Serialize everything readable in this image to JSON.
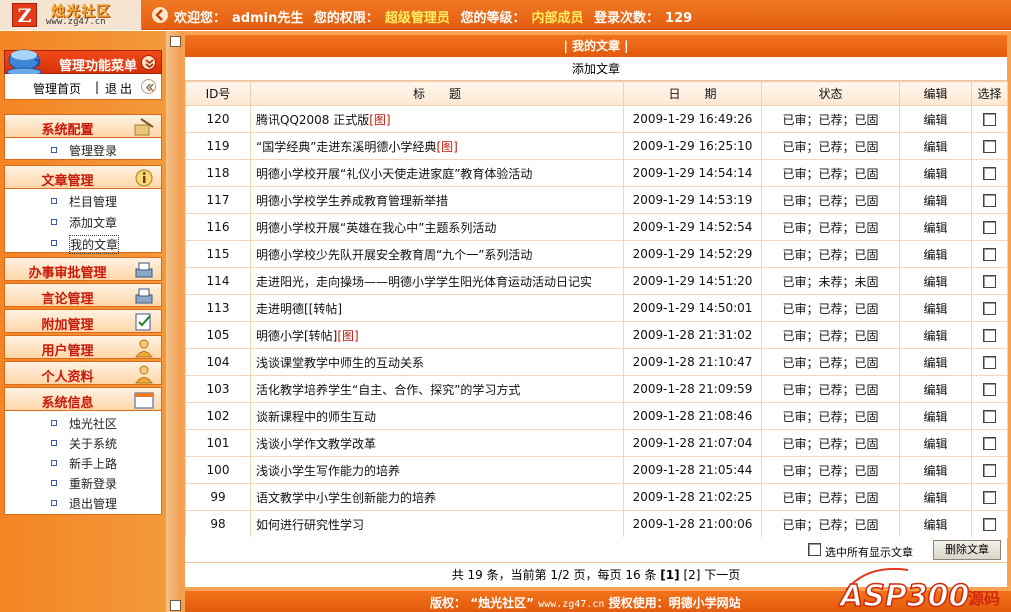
{
  "header": {
    "logo_letter": "Z",
    "logo_name": "烛光社区",
    "logo_url": "www.zg47.cn",
    "welcome_label": "欢迎您：",
    "username": "admin先生",
    "permission_label": "您的权限：",
    "permission": "超级管理员",
    "level_label": "您的等级：",
    "level": "内部成员",
    "login_count_label": "登录次数：",
    "login_count": "129"
  },
  "sidebar": {
    "manager_menu_title": "管理功能菜单",
    "home_link": "管理首页",
    "separator": "|",
    "exit_link": "退出",
    "sections": [
      {
        "title": "系统配置",
        "items": [
          "管理登录"
        ]
      },
      {
        "title": "文章管理",
        "items": [
          "栏目管理",
          "添加文章",
          "我的文章"
        ]
      },
      {
        "title": "办事审批管理",
        "items": []
      },
      {
        "title": "言论管理",
        "items": []
      },
      {
        "title": "附加管理",
        "items": []
      },
      {
        "title": "用户管理",
        "items": []
      },
      {
        "title": "个人资料",
        "items": []
      },
      {
        "title": "系统信息",
        "items": [
          "烛光社区",
          "关于系统",
          "新手上路",
          "重新登录",
          "退出管理"
        ]
      }
    ]
  },
  "main": {
    "title": "| 我的文章 |",
    "add_article": "添加文章",
    "columns": {
      "id": "ID号",
      "title": "标　　题",
      "date": "日　　期",
      "status": "状态",
      "edit": "编辑",
      "select": "选择"
    },
    "rows": [
      {
        "id": "120",
        "title": "腾讯QQ2008 正式版",
        "tag": "[图]",
        "date": "2009-1-29 16:49:26",
        "status": "已审；已荐；已固",
        "edit": "编辑"
      },
      {
        "id": "119",
        "title": "“国学经典”走进东溪明德小学经典",
        "tag": "[图]",
        "date": "2009-1-29 16:25:10",
        "status": "已审；已荐；已固",
        "edit": "编辑"
      },
      {
        "id": "118",
        "title": "明德小学校开展“礼仪小天使走进家庭”教育体验活动",
        "tag": "",
        "date": "2009-1-29 14:54:14",
        "status": "已审；已荐；已固",
        "edit": "编辑"
      },
      {
        "id": "117",
        "title": "明德小学校学生养成教育管理新举措",
        "tag": "",
        "date": "2009-1-29 14:53:19",
        "status": "已审；已荐；已固",
        "edit": "编辑"
      },
      {
        "id": "116",
        "title": "明德小学校开展“英雄在我心中”主题系列活动",
        "tag": "",
        "date": "2009-1-29 14:52:54",
        "status": "已审；已荐；已固",
        "edit": "编辑"
      },
      {
        "id": "115",
        "title": "明德小学校少先队开展安全教育周“九个一”系列活动",
        "tag": "",
        "date": "2009-1-29 14:52:29",
        "status": "已审；已荐；已固",
        "edit": "编辑"
      },
      {
        "id": "114",
        "title": "走进阳光，走向操场——明德小学学生阳光体育运动活动日记实",
        "tag": "",
        "date": "2009-1-29 14:51:20",
        "status": "已审；未荐；未固",
        "edit": "编辑"
      },
      {
        "id": "113",
        "title": "走进明德[[转帖]",
        "tag": "",
        "date": "2009-1-29 14:50:01",
        "status": "已审；已荐；已固",
        "edit": "编辑"
      },
      {
        "id": "105",
        "title": "明德小学[转帖]",
        "tag": "[图]",
        "date": "2009-1-28 21:31:02",
        "status": "已审；已荐；已固",
        "edit": "编辑"
      },
      {
        "id": "104",
        "title": "浅谈课堂教学中师生的互动关系",
        "tag": "",
        "date": "2009-1-28 21:10:47",
        "status": "已审；已荐；已固",
        "edit": "编辑"
      },
      {
        "id": "103",
        "title": "活化教学培养学生“自主、合作、探究”的学习方式",
        "tag": "",
        "date": "2009-1-28 21:09:59",
        "status": "已审；已荐；已固",
        "edit": "编辑"
      },
      {
        "id": "102",
        "title": "谈新课程中的师生互动",
        "tag": "",
        "date": "2009-1-28 21:08:46",
        "status": "已审；已荐；已固",
        "edit": "编辑"
      },
      {
        "id": "101",
        "title": "浅谈小学作文教学改革",
        "tag": "",
        "date": "2009-1-28 21:07:04",
        "status": "已审；已荐；已固",
        "edit": "编辑"
      },
      {
        "id": "100",
        "title": "浅谈小学生写作能力的培养",
        "tag": "",
        "date": "2009-1-28 21:05:44",
        "status": "已审；已荐；已固",
        "edit": "编辑"
      },
      {
        "id": "99",
        "title": "语文教学中小学生创新能力的培养",
        "tag": "",
        "date": "2009-1-28 21:02:25",
        "status": "已审；已荐；已固",
        "edit": "编辑"
      },
      {
        "id": "98",
        "title": "如何进行研究性学习",
        "tag": "",
        "date": "2009-1-28 21:00:06",
        "status": "已审；已荐；已固",
        "edit": "编辑"
      }
    ],
    "select_all_label": "选中所有显示文章",
    "delete_button": "删除文章",
    "pager": {
      "prefix": "共 19 条，当前第 1/2 页，每页 16 条",
      "current": "[1]",
      "next_page": "[2]",
      "next_label": "下一页"
    }
  },
  "footer": {
    "copyright_label": "版权：",
    "site_name": "“烛光社区”",
    "site_url": "www.zg47.cn",
    "license_label": "授权使用：",
    "licensee": "明德小学网站"
  },
  "watermark": {
    "text": "ASP300",
    "suffix": "源码"
  },
  "colors": {
    "accent": "#f07a24",
    "accent_dark": "#e35a0c",
    "section_title": "#c8180a",
    "tag": "#c31a0a"
  }
}
